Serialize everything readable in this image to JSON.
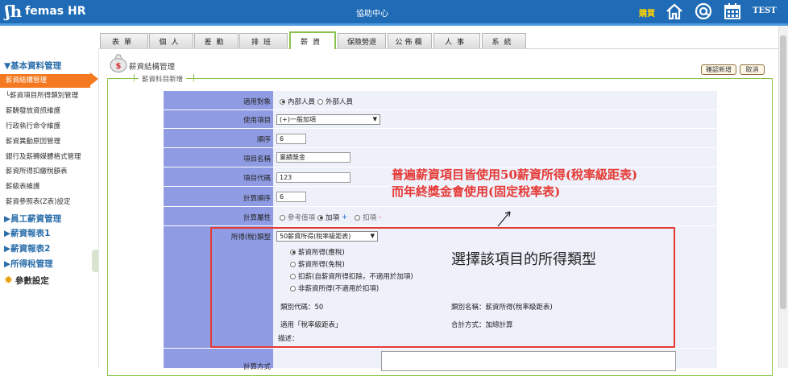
{
  "header": {
    "logo_text": "femas HR",
    "title": "協助中心",
    "buy_label": "購買",
    "user": "TEST",
    "icons": [
      "home-icon",
      "at-icon",
      "calendar-icon"
    ]
  },
  "tabs": [
    {
      "label": "表單",
      "active": false
    },
    {
      "label": "個人",
      "active": false
    },
    {
      "label": "差勤",
      "active": false
    },
    {
      "label": "排班",
      "active": false
    },
    {
      "label": "薪資",
      "active": true
    },
    {
      "label": "保險勞退",
      "active": false
    },
    {
      "label": "公佈欄",
      "active": false
    },
    {
      "label": "人事",
      "active": false
    },
    {
      "label": "系統",
      "active": false
    }
  ],
  "sidebar": {
    "section_basic": "▼基本資料管理",
    "items": [
      "薪資結構管理",
      "└薪資項目所得類別管理",
      "薪酬發放資訊維護",
      "行政執行命令維護",
      "薪資異動原因管理",
      "銀行及薪轉媒體格式管理",
      "薪資所得扣繳稅額表",
      "薪級表維護",
      "薪資參照表(Z表)設定"
    ],
    "section_emp": "▶員工薪資管理",
    "section_report1": "▶薪資報表1",
    "section_report2": "▶薪資報表2",
    "section_tax": "▶所得稅管理",
    "section_param": "參數設定"
  },
  "page": {
    "title": "薪資結構管理",
    "confirm_button": "確認新增",
    "cancel_button": "取消",
    "legend": "薪資科目新增"
  },
  "form": {
    "target_label": "適用對象",
    "target_internal": "內部人員",
    "target_external": "外部人員",
    "use_item_label": "使用項目",
    "use_item_value": "(+)一般加項",
    "order_label": "順序",
    "order_value": "6",
    "item_name_label": "項目名稱",
    "item_name_value": "業績獎金",
    "item_code_label": "項目代碼",
    "item_code_value": "123",
    "calc_order_label": "計算順序",
    "calc_order_value": "6",
    "calc_attr_label": "計算屬性",
    "calc_ref": "參考值項",
    "calc_add": "加項",
    "calc_add_sign": "+",
    "calc_sub": "扣項",
    "calc_sub_sign": "-",
    "income_type_label": "所得(稅)類型",
    "income_type_value": "50薪資所得(稅率級距表)",
    "opt_taxable": "薪資所得(應稅)",
    "opt_exempt": "薪資所得(免稅)",
    "opt_deduct": "扣薪(自薪資所得扣除，不適用於加項)",
    "opt_non": "非薪資所得(不適用於扣項)",
    "category_code": "類別代碼：50",
    "category_name": "類別名稱：薪資所得(稅率級距表)",
    "applies": "適用「稅率級距表」",
    "sum_method": "合計方式：加總計算",
    "description": "描述：",
    "formula_label": "計算方式"
  },
  "annotations": {
    "note_line1": "普遍薪資項目皆使用50薪資所得(稅率級距表)",
    "note_line2": "而年終獎金會使用(固定稅率表)",
    "note_box": "選擇該項目的所得類型"
  }
}
